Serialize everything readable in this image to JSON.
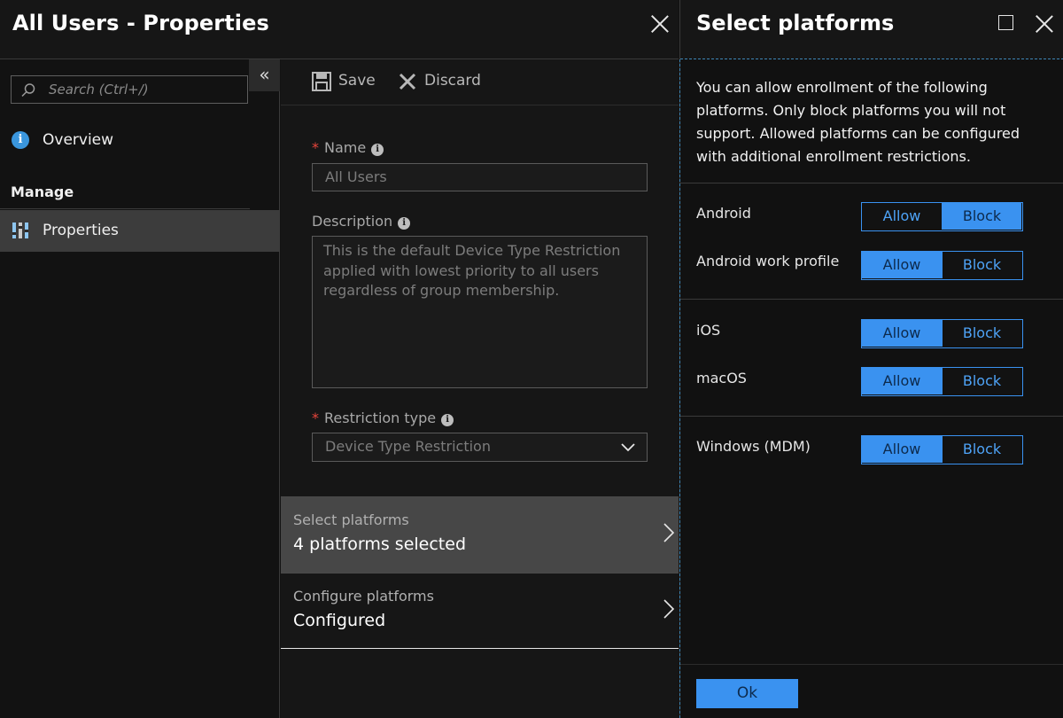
{
  "left_blade": {
    "title": "All Users - Properties",
    "sidebar": {
      "collapse_icon": "double-chevron-left-icon",
      "search_placeholder": "Search (Ctrl+/)",
      "overview_label": "Overview",
      "section_manage": "Manage",
      "properties_label": "Properties"
    },
    "toolbar": {
      "save_label": "Save",
      "discard_label": "Discard"
    },
    "form": {
      "name_label": "Name",
      "name_value": "All Users",
      "description_label": "Description",
      "description_value": "This is the default Device Type Restriction applied with lowest priority to all users regardless of group membership.",
      "restriction_label": "Restriction type",
      "restriction_value": "Device Type Restriction",
      "required_mark": "*"
    },
    "nav_rows": [
      {
        "label": "Select platforms",
        "value": "4 platforms selected"
      },
      {
        "label": "Configure platforms",
        "value": "Configured"
      }
    ]
  },
  "right_blade": {
    "title": "Select platforms",
    "description": "You can allow enrollment of the following platforms. Only block platforms you will not support. Allowed platforms can be configured with additional enrollment restrictions.",
    "allow_label": "Allow",
    "block_label": "Block",
    "platforms": [
      {
        "name": "Android",
        "state": "Block"
      },
      {
        "name": "Android work profile",
        "state": "Allow"
      },
      {
        "name": "iOS",
        "state": "Allow"
      },
      {
        "name": "macOS",
        "state": "Allow"
      },
      {
        "name": "Windows (MDM)",
        "state": "Allow"
      }
    ],
    "ok_label": "Ok"
  },
  "colors": {
    "accent": "#3a92f0",
    "required": "#e8453c",
    "info": "#3a96dd"
  }
}
